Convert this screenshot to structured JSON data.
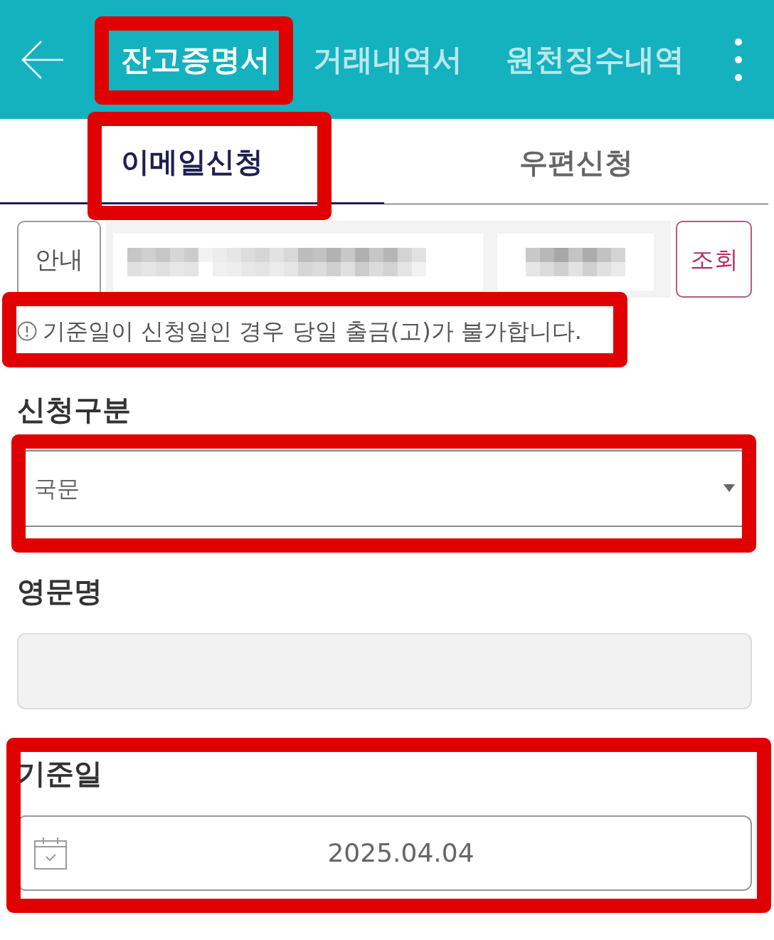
{
  "header": {
    "tabs": [
      {
        "label": "잔고증명서",
        "selected": true,
        "highlighted": true
      },
      {
        "label": "거래내역서",
        "selected": false,
        "highlighted": false
      },
      {
        "label": "원천징수내역",
        "selected": false,
        "highlighted": false
      }
    ]
  },
  "sub_tabs": [
    {
      "label": "이메일신청",
      "selected": true,
      "highlighted": true
    },
    {
      "label": "우편신청",
      "selected": false,
      "highlighted": false
    }
  ],
  "account_row": {
    "info_button": "안내",
    "search_button": "조회"
  },
  "notice": {
    "text": "기준일이 신청일인 경우 당일 출금(고)가 불가합니다.",
    "highlighted": true
  },
  "fields": [
    {
      "kind": "select",
      "label": "신청구분",
      "value": "국문",
      "disabled": false,
      "control_highlighted": true,
      "section_highlighted": false
    },
    {
      "kind": "text",
      "label": "영문명",
      "disabled": true,
      "control_highlighted": false,
      "section_highlighted": false
    },
    {
      "kind": "date",
      "label": "기준일",
      "value": "2025.04.04",
      "disabled": false,
      "control_highlighted": false,
      "section_highlighted": true
    }
  ]
}
